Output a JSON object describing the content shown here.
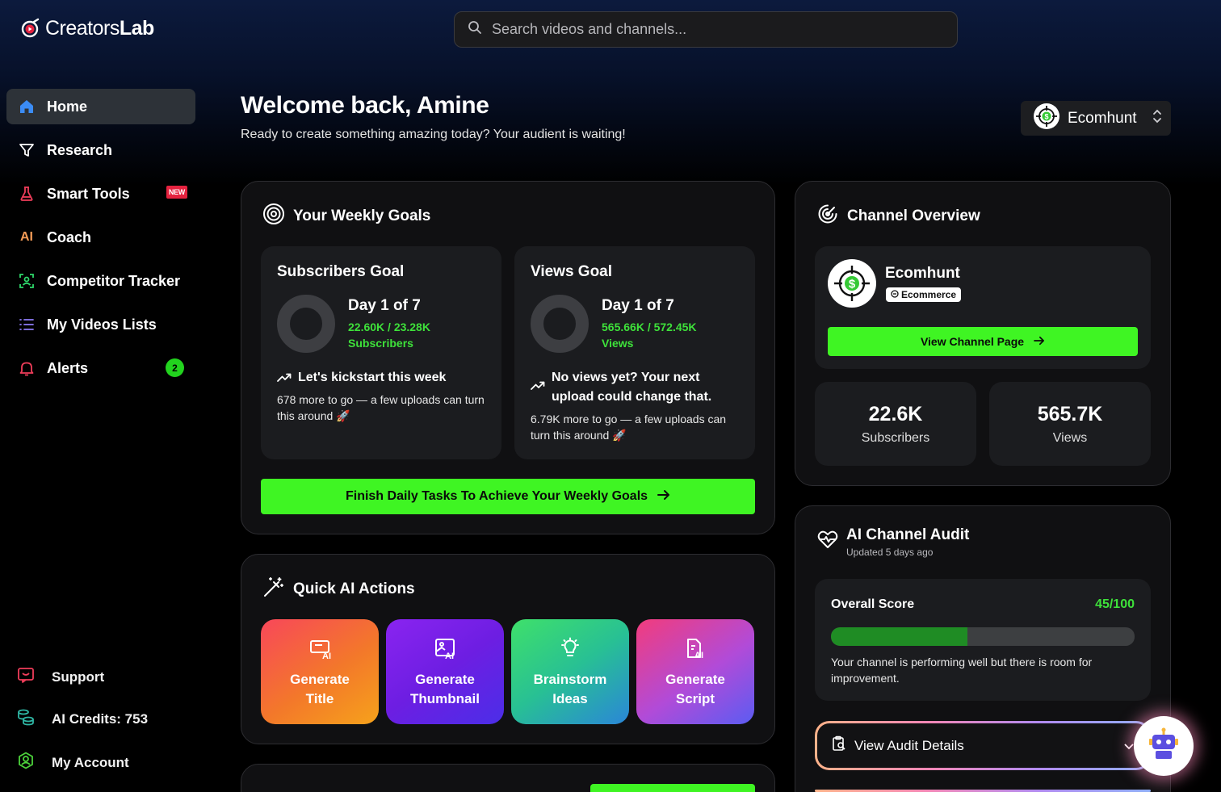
{
  "brand": {
    "name_light": "Creators",
    "name_bold": "Lab"
  },
  "search": {
    "placeholder": "Search videos and channels..."
  },
  "sidebar": {
    "items": [
      {
        "label": "Home"
      },
      {
        "label": "Research"
      },
      {
        "label": "Smart Tools",
        "badge": "NEW"
      },
      {
        "label": "Coach",
        "icon_text": "AI"
      },
      {
        "label": "Competitor Tracker"
      },
      {
        "label": "My Videos Lists"
      },
      {
        "label": "Alerts",
        "count": "2"
      }
    ],
    "footer": [
      {
        "label": "Support"
      },
      {
        "label": "AI Credits: 753"
      },
      {
        "label": "My Account"
      }
    ]
  },
  "header": {
    "welcome": "Welcome back, Amine",
    "subtitle": "Ready to create something amazing today? Your audient is waiting!",
    "channel_select": "Ecomhunt"
  },
  "weekly_goals": {
    "title": "Your Weekly Goals",
    "subscribers": {
      "title": "Subscribers Goal",
      "day": "Day 1 of 7",
      "progress": "22.60K / 23.28K",
      "unit": "Subscribers",
      "message": "Let's kickstart this week",
      "detail": "678 more to go — a few uploads can turn this around 🚀"
    },
    "views": {
      "title": "Views Goal",
      "day": "Day 1 of 7",
      "progress": "565.66K / 572.45K",
      "unit": "Views",
      "message": "No views yet? Your next upload could change that.",
      "detail": "6.79K more to go — a few uploads can turn this around 🚀"
    },
    "cta": "Finish Daily Tasks To Achieve Your Weekly Goals"
  },
  "quick_actions": {
    "title": "Quick AI Actions",
    "items": [
      {
        "line1": "Generate",
        "line2": "Title"
      },
      {
        "line1": "Generate",
        "line2": "Thumbnail"
      },
      {
        "line1": "Brainstorm",
        "line2": "Ideas"
      },
      {
        "line1": "Generate",
        "line2": "Script"
      }
    ]
  },
  "channel_overview": {
    "title": "Channel Overview",
    "name": "Ecomhunt",
    "category": "Ecommerce",
    "cta": "View Channel Page",
    "stats": [
      {
        "value": "22.6K",
        "label": "Subscribers"
      },
      {
        "value": "565.7K",
        "label": "Views"
      }
    ]
  },
  "audit": {
    "title": "AI Channel Audit",
    "updated": "Updated 5 days ago",
    "score_label": "Overall Score",
    "score": "45/100",
    "score_fraction": 0.45,
    "summary": "Your channel is performing well but there is room for improvement.",
    "details_button": "View Audit Details"
  },
  "colors": {
    "accent_green": "#3ff523",
    "badge_red": "#e5223f",
    "progress_green": "#1f8c24"
  }
}
